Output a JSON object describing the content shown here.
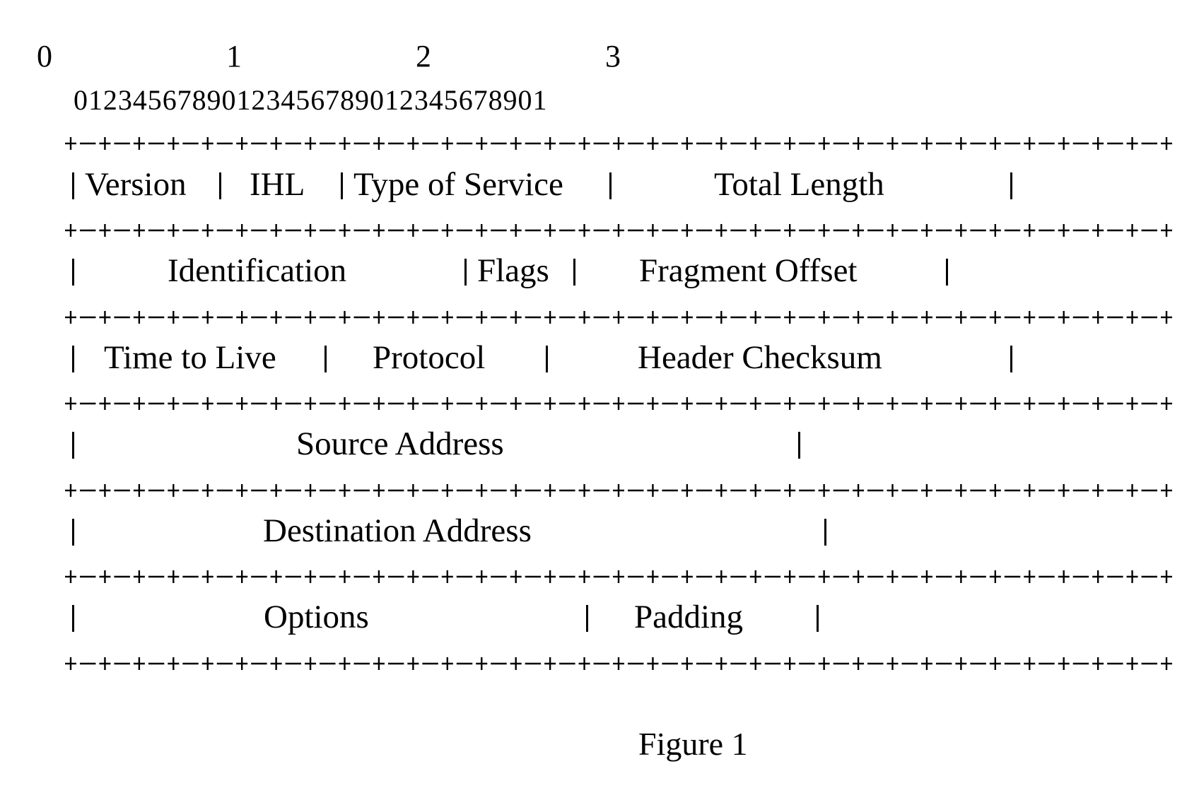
{
  "figure": {
    "octet_labels": [
      "0",
      "1",
      "2",
      "3"
    ],
    "bit_numbers": "01234567890123456789012345678901",
    "rows": [
      {
        "fields": [
          "Version",
          "IHL",
          "Type of Service",
          "Total Length"
        ]
      },
      {
        "fields": [
          "Identification",
          "Flags",
          "Fragment Offset"
        ]
      },
      {
        "fields": [
          "Time to Live",
          "Protocol",
          "Header Checksum"
        ]
      },
      {
        "fields": [
          "Source Address"
        ]
      },
      {
        "fields": [
          "Destination Address"
        ]
      },
      {
        "fields": [
          "Options",
          "Padding"
        ]
      }
    ],
    "caption": "Figure 1"
  }
}
